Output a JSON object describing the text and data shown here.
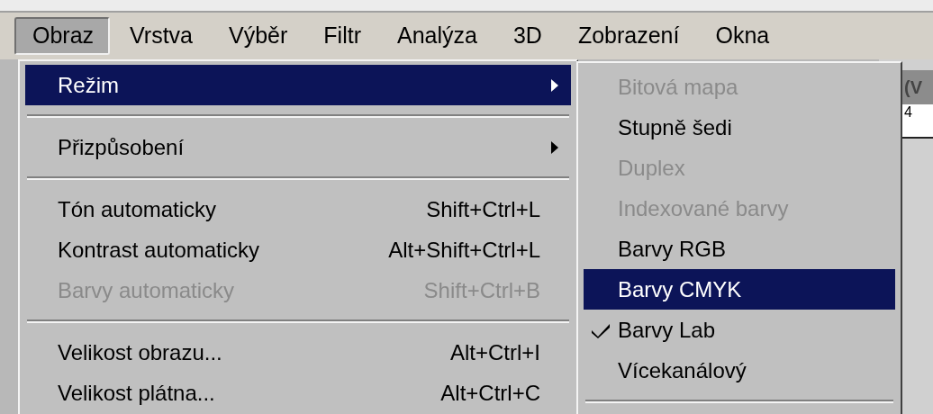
{
  "menu_bar": [
    {
      "label": "Obraz",
      "selected": true
    },
    {
      "label": "Vrstva",
      "selected": false
    },
    {
      "label": "Výběr",
      "selected": false
    },
    {
      "label": "Filtr",
      "selected": false
    },
    {
      "label": "Analýza",
      "selected": false
    },
    {
      "label": "3D",
      "selected": false
    },
    {
      "label": "Zobrazení",
      "selected": false
    },
    {
      "label": "Okna",
      "selected": false
    }
  ],
  "background_window": {
    "title": "(V",
    "ruler_label": "4"
  },
  "main_menu": [
    {
      "kind": "item",
      "label": "Režim",
      "has_submenu": true,
      "disabled": false,
      "selected": true
    },
    {
      "kind": "separator"
    },
    {
      "kind": "item",
      "label": "Přizpůsobení",
      "has_submenu": true,
      "disabled": false,
      "selected": false
    },
    {
      "kind": "separator"
    },
    {
      "kind": "item",
      "label": "Tón automaticky",
      "shortcut": "Shift+Ctrl+L",
      "disabled": false,
      "selected": false
    },
    {
      "kind": "item",
      "label": "Kontrast automaticky",
      "shortcut": "Alt+Shift+Ctrl+L",
      "disabled": false,
      "selected": false
    },
    {
      "kind": "item",
      "label": "Barvy automaticky",
      "shortcut": "Shift+Ctrl+B",
      "disabled": true,
      "selected": false
    },
    {
      "kind": "separator"
    },
    {
      "kind": "item",
      "label": "Velikost obrazu...",
      "shortcut": "Alt+Ctrl+I",
      "disabled": false,
      "selected": false
    },
    {
      "kind": "item",
      "label": "Velikost plátna...",
      "shortcut": "Alt+Ctrl+C",
      "disabled": false,
      "selected": false
    }
  ],
  "submenu": [
    {
      "kind": "item",
      "label": "Bitová mapa",
      "disabled": true,
      "selected": false,
      "checked": false
    },
    {
      "kind": "item",
      "label": "Stupně šedi",
      "disabled": false,
      "selected": false,
      "checked": false
    },
    {
      "kind": "item",
      "label": "Duplex",
      "disabled": true,
      "selected": false,
      "checked": false
    },
    {
      "kind": "item",
      "label": "Indexované barvy",
      "disabled": true,
      "selected": false,
      "checked": false
    },
    {
      "kind": "item",
      "label": "Barvy RGB",
      "disabled": false,
      "selected": false,
      "checked": false
    },
    {
      "kind": "item",
      "label": "Barvy CMYK",
      "disabled": false,
      "selected": true,
      "checked": false
    },
    {
      "kind": "item",
      "label": "Barvy Lab",
      "disabled": false,
      "selected": false,
      "checked": true
    },
    {
      "kind": "item",
      "label": "Vícekanálový",
      "disabled": false,
      "selected": false,
      "checked": false
    },
    {
      "kind": "separator"
    }
  ]
}
